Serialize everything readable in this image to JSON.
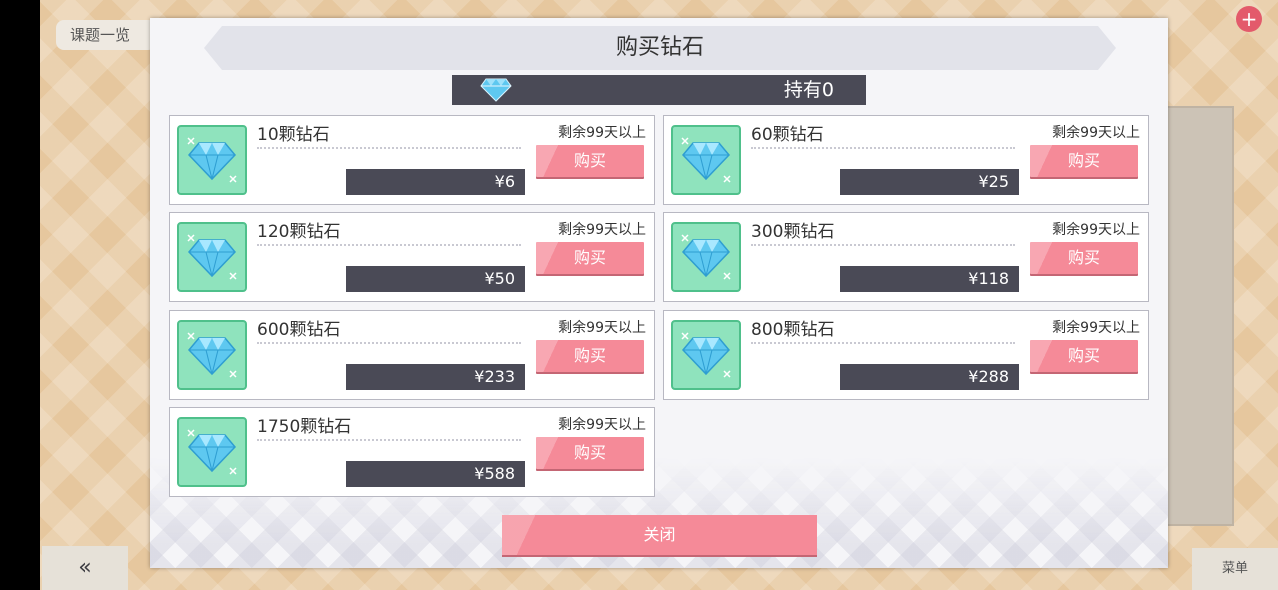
{
  "dialog": {
    "title": "购买钻石",
    "owned_label": "持有0",
    "close_label": "关闭"
  },
  "items": [
    {
      "name": "10颗钻石",
      "price": "¥6",
      "remaining": "剩余99天以上",
      "buy_label": "购买"
    },
    {
      "name": "60颗钻石",
      "price": "¥25",
      "remaining": "剩余99天以上",
      "buy_label": "购买"
    },
    {
      "name": "120颗钻石",
      "price": "¥50",
      "remaining": "剩余99天以上",
      "buy_label": "购买"
    },
    {
      "name": "300颗钻石",
      "price": "¥118",
      "remaining": "剩余99天以上",
      "buy_label": "购买"
    },
    {
      "name": "600颗钻石",
      "price": "¥233",
      "remaining": "剩余99天以上",
      "buy_label": "购买"
    },
    {
      "name": "800颗钻石",
      "price": "¥288",
      "remaining": "剩余99天以上",
      "buy_label": "购买"
    },
    {
      "name": "1750颗钻石",
      "price": "¥588",
      "remaining": "剩余99天以上",
      "buy_label": "购买"
    }
  ],
  "background": {
    "top_left_label": "课题一览",
    "back_icon": "double-chevron-left-icon",
    "plus_icon": "plus-icon",
    "menu_label": "菜单"
  },
  "colors": {
    "accent_pink": "#f58a98",
    "dark_bar": "#4a4a56",
    "diamond_tile": "#8fe3bd",
    "diamond_blue": "#5ec8f0"
  }
}
